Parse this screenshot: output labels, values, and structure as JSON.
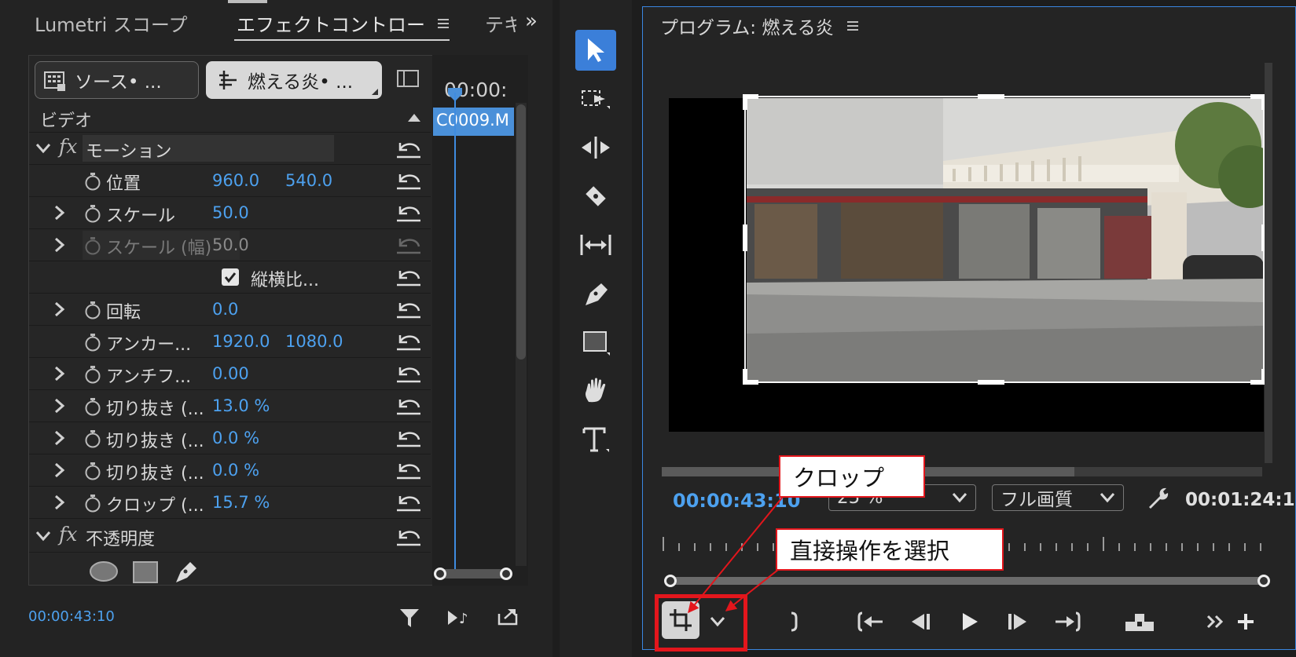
{
  "effect_controls": {
    "tabs": [
      {
        "label": "Lumetri スコープ"
      },
      {
        "label": "エフェクトコントロー",
        "menu_icon": "hamburger-icon"
      },
      {
        "label": "テキ"
      }
    ],
    "overflow_label": "»",
    "source_button": "ソース• ...",
    "sequence_button": "燃える炎• ...",
    "section_label": "ビデオ",
    "playhead_time": "00:00:",
    "clip_label": "C0009.M",
    "motion_label": "モーション",
    "properties": {
      "position": {
        "label": "位置",
        "x": "960.0",
        "y": "540.0"
      },
      "scale": {
        "label": "スケール",
        "value": "50.0"
      },
      "scale_width": {
        "label": "スケール (幅)",
        "value": "50.0"
      },
      "uniform": {
        "label": "縦横比..."
      },
      "rotation": {
        "label": "回転",
        "value": "0.0"
      },
      "anchor": {
        "label": "アンカー...",
        "x": "1920.0",
        "y": "1080.0"
      },
      "antiflicker": {
        "label": "アンチフ...",
        "value": "0.00"
      },
      "crop1": {
        "label": "切り抜き (...",
        "value": "13.0 %"
      },
      "crop2": {
        "label": "切り抜き (...",
        "value": "0.0 %"
      },
      "crop3": {
        "label": "切り抜き (...",
        "value": "0.0 %"
      },
      "crop4": {
        "label": "クロップ (...",
        "value": "15.7 %"
      }
    },
    "fx_symbol": "fx",
    "opacity_label": "不透明度",
    "current_time": "00:00:43:10"
  },
  "program": {
    "title": "プログラム: 燃える炎",
    "current_timecode": "00:00:43:10",
    "zoom": "25 %",
    "quality": "フル画質",
    "duration": "00:01:24:1"
  },
  "annotations": {
    "crop": "クロップ",
    "direct_manipulation": "直接操作を選択"
  },
  "colors": {
    "accent": "#4da1ef",
    "highlight": "#e3161c",
    "active_tool": "#3b7fd9"
  }
}
